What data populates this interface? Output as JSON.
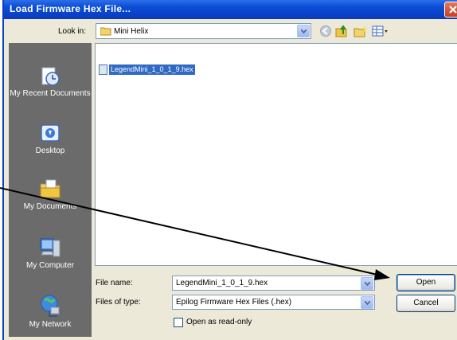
{
  "dialog": {
    "title": "Load Firmware Hex File..."
  },
  "lookin": {
    "label": "Look in:",
    "value": "Mini Helix"
  },
  "toolbar": {
    "icons": [
      "back-icon",
      "up-folder-icon",
      "new-folder-icon",
      "view-menu-icon"
    ]
  },
  "places": [
    {
      "label": "My Recent Documents",
      "icon": "recent-documents-icon"
    },
    {
      "label": "Desktop",
      "icon": "desktop-icon"
    },
    {
      "label": "My Documents",
      "icon": "my-documents-icon"
    },
    {
      "label": "My Computer",
      "icon": "my-computer-icon"
    },
    {
      "label": "My Network",
      "icon": "my-network-icon"
    }
  ],
  "files": [
    {
      "name": "LegendMini_1_0_1_9.hex"
    }
  ],
  "filename": {
    "label": "File name:",
    "value": "LegendMini_1_0_1_9.hex"
  },
  "filetype": {
    "label": "Files of type:",
    "value": "Epilog Firmware Hex Files (.hex)"
  },
  "readonly": {
    "label": "Open as read-only"
  },
  "buttons": {
    "open": "Open",
    "cancel": "Cancel"
  },
  "colors": {
    "titlebar": "#0a4fd6",
    "selection": "#316ac5",
    "places_bar": "#6b6b6b"
  }
}
